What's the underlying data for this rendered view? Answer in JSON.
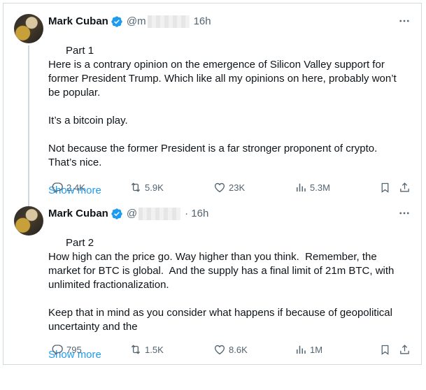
{
  "colors": {
    "accent": "#1d9bf0",
    "text": "#0f1419",
    "secondary": "#536471",
    "border": "#cfd9de"
  },
  "tweets": [
    {
      "author": "Mark Cuban",
      "handle": "@m",
      "time": "16h",
      "text": "Part 1\nHere is a contrary opinion on the emergence of Silicon Valley support for former President Trump. Which like all my opinions on here, probably won’t be popular.\n\nIt’s a bitcoin play.\n\nNot because the former President is a far stronger proponent of crypto. That’s nice.",
      "show_more": "Show more",
      "stats": {
        "replies": "2.4K",
        "reposts": "5.9K",
        "likes": "23K",
        "views": "5.3M"
      },
      "icons": [
        "verified-icon",
        "more-icon",
        "reply-icon",
        "repost-icon",
        "like-icon",
        "views-icon",
        "bookmark-icon",
        "share-icon"
      ]
    },
    {
      "author": "Mark Cuban",
      "handle": "@",
      "time": "· 16h",
      "text": "Part 2\nHow high can the price go. Way higher than you think.  Remember, the market for BTC is global.  And the supply has a final limit of 21m BTC, with unlimited fractionalization.\n\nKeep that in mind as you consider what happens if because of geopolitical uncertainty and the",
      "show_more": "Show more",
      "stats": {
        "replies": "795",
        "reposts": "1.5K",
        "likes": "8.6K",
        "views": "1M"
      },
      "icons": [
        "verified-icon",
        "more-icon",
        "reply-icon",
        "repost-icon",
        "like-icon",
        "views-icon",
        "bookmark-icon",
        "share-icon"
      ]
    }
  ]
}
